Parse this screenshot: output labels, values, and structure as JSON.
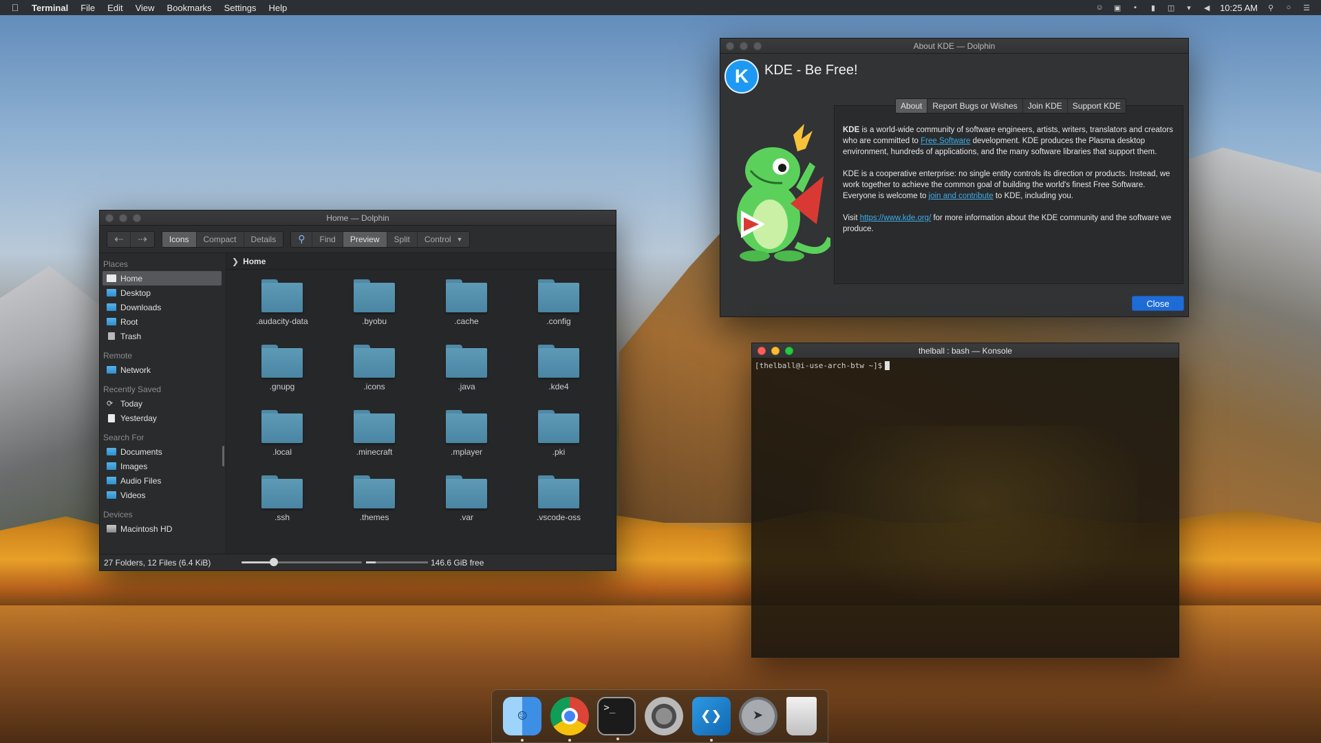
{
  "menubar": {
    "app": "Terminal",
    "items": [
      "File",
      "Edit",
      "View",
      "Bookmarks",
      "Settings",
      "Help"
    ],
    "clock": "10:25 AM",
    "tray_icons": [
      "user-icon",
      "display-icon",
      "lock-icon",
      "battery-icon",
      "clipboard-icon",
      "wifi-icon",
      "volume-icon",
      "search-icon",
      "notification-icon",
      "list-icon"
    ]
  },
  "dolphin": {
    "title": "Home — Dolphin",
    "view_modes": [
      "Icons",
      "Compact",
      "Details"
    ],
    "active_view": "Icons",
    "toolbar": {
      "find": "Find",
      "preview": "Preview",
      "split": "Split",
      "control": "Control"
    },
    "breadcrumb": "Home",
    "places": {
      "groups": [
        {
          "title": "Places",
          "items": [
            {
              "label": "Home",
              "icon": "home-icon",
              "selected": true
            },
            {
              "label": "Desktop",
              "icon": "folder-icon"
            },
            {
              "label": "Downloads",
              "icon": "folder-icon"
            },
            {
              "label": "Root",
              "icon": "folder-icon"
            },
            {
              "label": "Trash",
              "icon": "trash-icon"
            }
          ]
        },
        {
          "title": "Remote",
          "items": [
            {
              "label": "Network",
              "icon": "folder-icon"
            }
          ]
        },
        {
          "title": "Recently Saved",
          "items": [
            {
              "label": "Today",
              "icon": "clock-icon"
            },
            {
              "label": "Yesterday",
              "icon": "document-icon"
            }
          ]
        },
        {
          "title": "Search For",
          "items": [
            {
              "label": "Documents",
              "icon": "folder-icon"
            },
            {
              "label": "Images",
              "icon": "folder-icon"
            },
            {
              "label": "Audio Files",
              "icon": "folder-icon"
            },
            {
              "label": "Videos",
              "icon": "folder-icon"
            }
          ]
        },
        {
          "title": "Devices",
          "items": [
            {
              "label": "Macintosh HD",
              "icon": "harddrive-icon"
            }
          ]
        }
      ]
    },
    "files": [
      ".audacity-data",
      ".byobu",
      ".cache",
      ".config",
      ".gnupg",
      ".icons",
      ".java",
      ".kde4",
      ".local",
      ".minecraft",
      ".mplayer",
      ".pki",
      ".ssh",
      ".themes",
      ".var",
      ".vscode-oss"
    ],
    "status": {
      "summary": "27 Folders, 12 Files (6.4 KiB)",
      "free": "146.6 GiB free",
      "zoom_fraction": 0.27,
      "disk_used_fraction": 0.15
    }
  },
  "about": {
    "title": "About KDE — Dolphin",
    "heading": "KDE - Be Free!",
    "tabs": [
      "About",
      "Report Bugs or Wishes",
      "Join KDE",
      "Support KDE"
    ],
    "active_tab": "About",
    "p1_bold": "KDE",
    "p1_a": " is a world-wide community of software engineers, artists, writers, translators and creators who are committed to ",
    "p1_link": "Free Software",
    "p1_b": " development. KDE produces the Plasma desktop environment, hundreds of applications, and the many software libraries that support them.",
    "p2_a": "KDE is a cooperative enterprise: no single entity controls its direction or products. Instead, we work together to achieve the common goal of building the world's finest Free Software. Everyone is welcome to ",
    "p2_link": "join and contribute",
    "p2_b": " to KDE, including you.",
    "p3_a": "Visit ",
    "p3_link": "https://www.kde.org/",
    "p3_b": " for more information about the KDE community and the software we produce.",
    "close": "Close"
  },
  "konsole": {
    "title": "thelball : bash — Konsole",
    "prompt": "[thelball@i-use-arch-btw ~]$"
  },
  "dock": {
    "items": [
      {
        "name": "finder-icon",
        "running": true
      },
      {
        "name": "chrome-icon",
        "running": true
      },
      {
        "name": "terminal-icon",
        "running": true,
        "glyph": ">_"
      },
      {
        "name": "system-preferences-icon",
        "running": false
      },
      {
        "name": "vscode-icon",
        "running": true
      },
      {
        "name": "launchpad-icon",
        "running": false
      },
      {
        "name": "trash-icon",
        "running": false
      }
    ]
  },
  "colors": {
    "accent": "#1f6cd6",
    "link": "#3daee9",
    "folder": "#4a86a3",
    "kde_blue": "#1d99f3"
  }
}
